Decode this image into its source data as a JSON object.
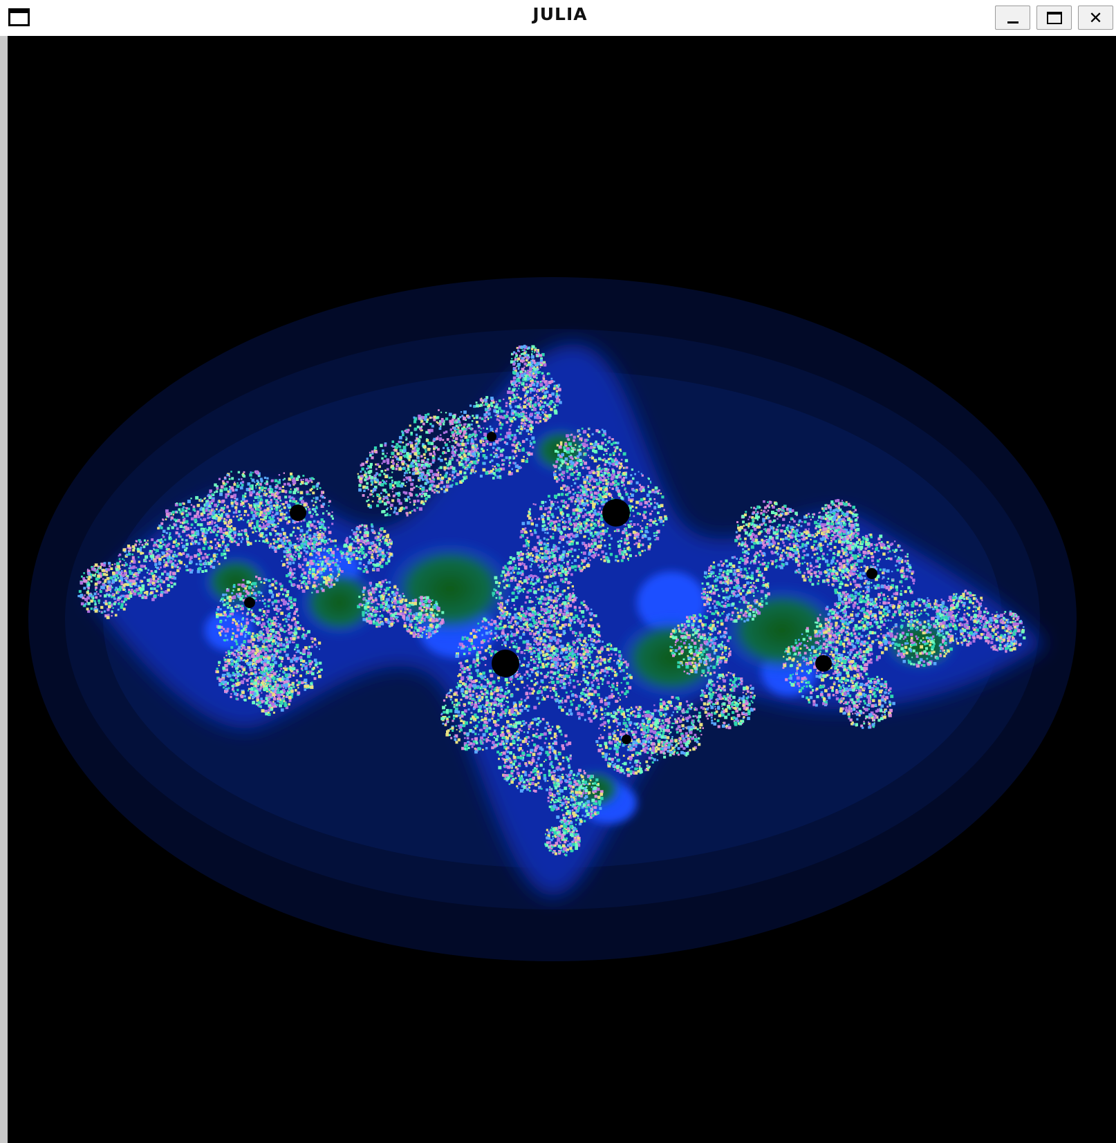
{
  "window": {
    "title": "JULIA",
    "controls": {
      "minimize_icon": "minimize-icon",
      "maximize_icon": "maximize-icon",
      "close_icon": "close-icon",
      "close_glyph": "✕"
    },
    "system_menu_icon": "window-icon"
  },
  "canvas": {
    "background": "#000000",
    "colors": {
      "halo_outer": "#020a28",
      "halo_mid": "#041344",
      "halo_inner": "#0a2a8a",
      "glow": "#1a4fff",
      "interior_green": "#0b5a16",
      "fractal_teal": "#2fd6b0",
      "fractal_pink": "#d98ad8",
      "fractal_mint": "#6fffc0"
    }
  }
}
